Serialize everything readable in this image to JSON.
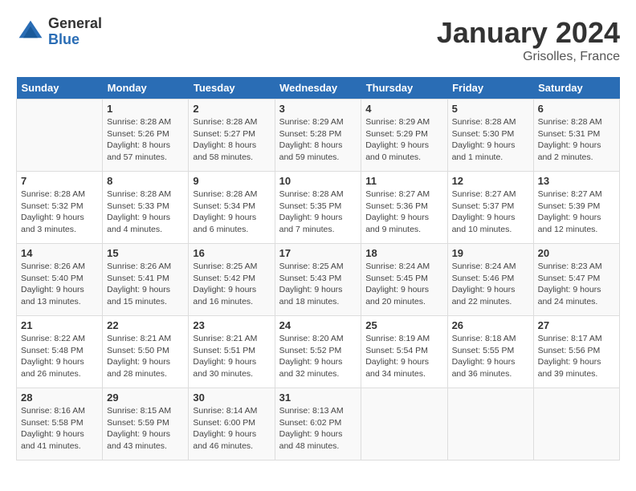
{
  "header": {
    "logo_general": "General",
    "logo_blue": "Blue",
    "month_title": "January 2024",
    "location": "Grisolles, France"
  },
  "weekdays": [
    "Sunday",
    "Monday",
    "Tuesday",
    "Wednesday",
    "Thursday",
    "Friday",
    "Saturday"
  ],
  "weeks": [
    [
      {
        "day": "",
        "info": ""
      },
      {
        "day": "1",
        "info": "Sunrise: 8:28 AM\nSunset: 5:26 PM\nDaylight: 8 hours\nand 57 minutes."
      },
      {
        "day": "2",
        "info": "Sunrise: 8:28 AM\nSunset: 5:27 PM\nDaylight: 8 hours\nand 58 minutes."
      },
      {
        "day": "3",
        "info": "Sunrise: 8:29 AM\nSunset: 5:28 PM\nDaylight: 8 hours\nand 59 minutes."
      },
      {
        "day": "4",
        "info": "Sunrise: 8:29 AM\nSunset: 5:29 PM\nDaylight: 9 hours\nand 0 minutes."
      },
      {
        "day": "5",
        "info": "Sunrise: 8:28 AM\nSunset: 5:30 PM\nDaylight: 9 hours\nand 1 minute."
      },
      {
        "day": "6",
        "info": "Sunrise: 8:28 AM\nSunset: 5:31 PM\nDaylight: 9 hours\nand 2 minutes."
      }
    ],
    [
      {
        "day": "7",
        "info": "Sunrise: 8:28 AM\nSunset: 5:32 PM\nDaylight: 9 hours\nand 3 minutes."
      },
      {
        "day": "8",
        "info": "Sunrise: 8:28 AM\nSunset: 5:33 PM\nDaylight: 9 hours\nand 4 minutes."
      },
      {
        "day": "9",
        "info": "Sunrise: 8:28 AM\nSunset: 5:34 PM\nDaylight: 9 hours\nand 6 minutes."
      },
      {
        "day": "10",
        "info": "Sunrise: 8:28 AM\nSunset: 5:35 PM\nDaylight: 9 hours\nand 7 minutes."
      },
      {
        "day": "11",
        "info": "Sunrise: 8:27 AM\nSunset: 5:36 PM\nDaylight: 9 hours\nand 9 minutes."
      },
      {
        "day": "12",
        "info": "Sunrise: 8:27 AM\nSunset: 5:37 PM\nDaylight: 9 hours\nand 10 minutes."
      },
      {
        "day": "13",
        "info": "Sunrise: 8:27 AM\nSunset: 5:39 PM\nDaylight: 9 hours\nand 12 minutes."
      }
    ],
    [
      {
        "day": "14",
        "info": "Sunrise: 8:26 AM\nSunset: 5:40 PM\nDaylight: 9 hours\nand 13 minutes."
      },
      {
        "day": "15",
        "info": "Sunrise: 8:26 AM\nSunset: 5:41 PM\nDaylight: 9 hours\nand 15 minutes."
      },
      {
        "day": "16",
        "info": "Sunrise: 8:25 AM\nSunset: 5:42 PM\nDaylight: 9 hours\nand 16 minutes."
      },
      {
        "day": "17",
        "info": "Sunrise: 8:25 AM\nSunset: 5:43 PM\nDaylight: 9 hours\nand 18 minutes."
      },
      {
        "day": "18",
        "info": "Sunrise: 8:24 AM\nSunset: 5:45 PM\nDaylight: 9 hours\nand 20 minutes."
      },
      {
        "day": "19",
        "info": "Sunrise: 8:24 AM\nSunset: 5:46 PM\nDaylight: 9 hours\nand 22 minutes."
      },
      {
        "day": "20",
        "info": "Sunrise: 8:23 AM\nSunset: 5:47 PM\nDaylight: 9 hours\nand 24 minutes."
      }
    ],
    [
      {
        "day": "21",
        "info": "Sunrise: 8:22 AM\nSunset: 5:48 PM\nDaylight: 9 hours\nand 26 minutes."
      },
      {
        "day": "22",
        "info": "Sunrise: 8:21 AM\nSunset: 5:50 PM\nDaylight: 9 hours\nand 28 minutes."
      },
      {
        "day": "23",
        "info": "Sunrise: 8:21 AM\nSunset: 5:51 PM\nDaylight: 9 hours\nand 30 minutes."
      },
      {
        "day": "24",
        "info": "Sunrise: 8:20 AM\nSunset: 5:52 PM\nDaylight: 9 hours\nand 32 minutes."
      },
      {
        "day": "25",
        "info": "Sunrise: 8:19 AM\nSunset: 5:54 PM\nDaylight: 9 hours\nand 34 minutes."
      },
      {
        "day": "26",
        "info": "Sunrise: 8:18 AM\nSunset: 5:55 PM\nDaylight: 9 hours\nand 36 minutes."
      },
      {
        "day": "27",
        "info": "Sunrise: 8:17 AM\nSunset: 5:56 PM\nDaylight: 9 hours\nand 39 minutes."
      }
    ],
    [
      {
        "day": "28",
        "info": "Sunrise: 8:16 AM\nSunset: 5:58 PM\nDaylight: 9 hours\nand 41 minutes."
      },
      {
        "day": "29",
        "info": "Sunrise: 8:15 AM\nSunset: 5:59 PM\nDaylight: 9 hours\nand 43 minutes."
      },
      {
        "day": "30",
        "info": "Sunrise: 8:14 AM\nSunset: 6:00 PM\nDaylight: 9 hours\nand 46 minutes."
      },
      {
        "day": "31",
        "info": "Sunrise: 8:13 AM\nSunset: 6:02 PM\nDaylight: 9 hours\nand 48 minutes."
      },
      {
        "day": "",
        "info": ""
      },
      {
        "day": "",
        "info": ""
      },
      {
        "day": "",
        "info": ""
      }
    ]
  ]
}
